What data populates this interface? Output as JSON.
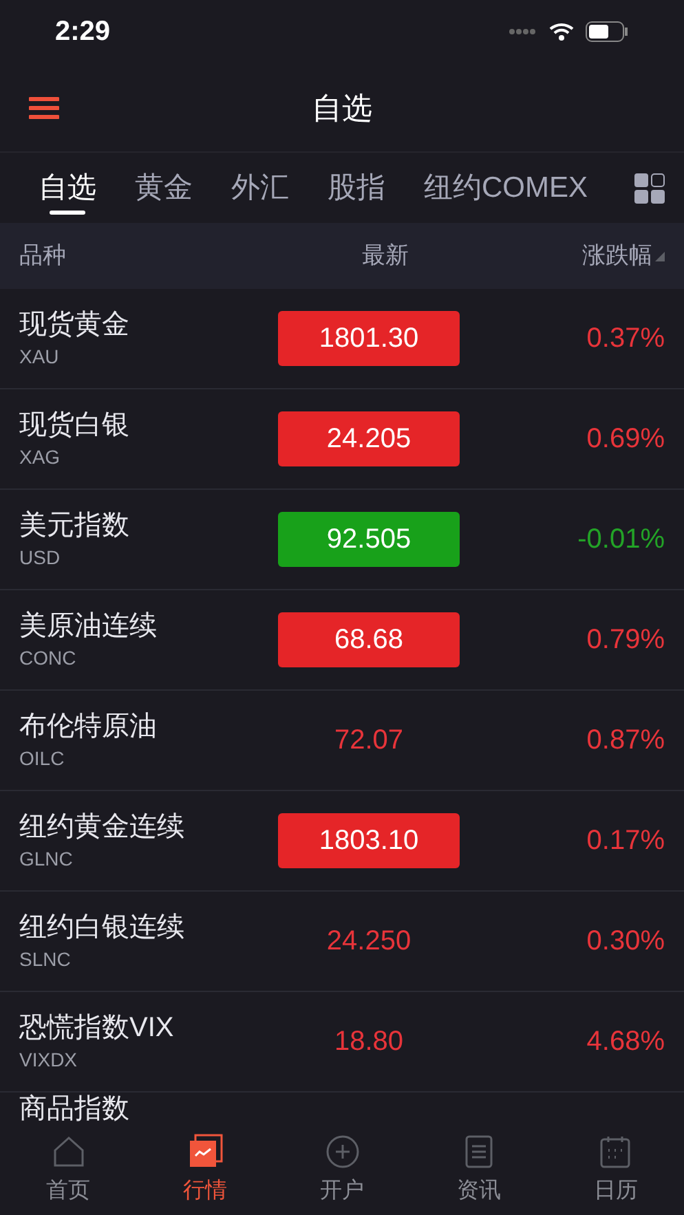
{
  "status_bar": {
    "time": "2:29"
  },
  "header": {
    "title": "自选"
  },
  "tabs": [
    {
      "label": "自选",
      "selected": true
    },
    {
      "label": "黄金",
      "selected": false
    },
    {
      "label": "外汇",
      "selected": false
    },
    {
      "label": "股指",
      "selected": false
    },
    {
      "label": "纽约COMEX",
      "selected": false
    }
  ],
  "table": {
    "columns": [
      "品种",
      "最新",
      "涨跌幅"
    ],
    "rows": [
      {
        "name": "现货黄金",
        "code": "XAU",
        "price": "1801.30",
        "change": "0.37%",
        "up": true,
        "kind": "boxed"
      },
      {
        "name": "现货白银",
        "code": "XAG",
        "price": "24.205",
        "change": "0.69%",
        "up": true,
        "kind": "boxed"
      },
      {
        "name": "美元指数",
        "code": "USD",
        "price": "92.505",
        "change": "-0.01%",
        "up": false,
        "kind": "boxed"
      },
      {
        "name": "美原油连续",
        "code": "CONC",
        "price": "68.68",
        "change": "0.79%",
        "up": true,
        "kind": "boxed"
      },
      {
        "name": "布伦特原油",
        "code": "OILC",
        "price": "72.07",
        "change": "0.87%",
        "up": true,
        "kind": "plain"
      },
      {
        "name": "纽约黄金连续",
        "code": "GLNC",
        "price": "1803.10",
        "change": "0.17%",
        "up": true,
        "kind": "boxed"
      },
      {
        "name": "纽约白银连续",
        "code": "SLNC",
        "price": "24.250",
        "change": "0.30%",
        "up": true,
        "kind": "plain"
      },
      {
        "name": "恐慌指数VIX",
        "code": "VIXDX",
        "price": "18.80",
        "change": "4.68%",
        "up": true,
        "kind": "plain"
      },
      {
        "name": "商品指数"
      }
    ]
  },
  "bottom_nav": [
    {
      "label": "首页",
      "selected": false,
      "kind": "home"
    },
    {
      "label": "行情",
      "selected": true,
      "kind": "market"
    },
    {
      "label": "开户",
      "selected": false,
      "kind": "plus"
    },
    {
      "label": "资讯",
      "selected": false,
      "kind": "news"
    },
    {
      "label": "日历",
      "selected": false,
      "kind": "calendar"
    }
  ]
}
